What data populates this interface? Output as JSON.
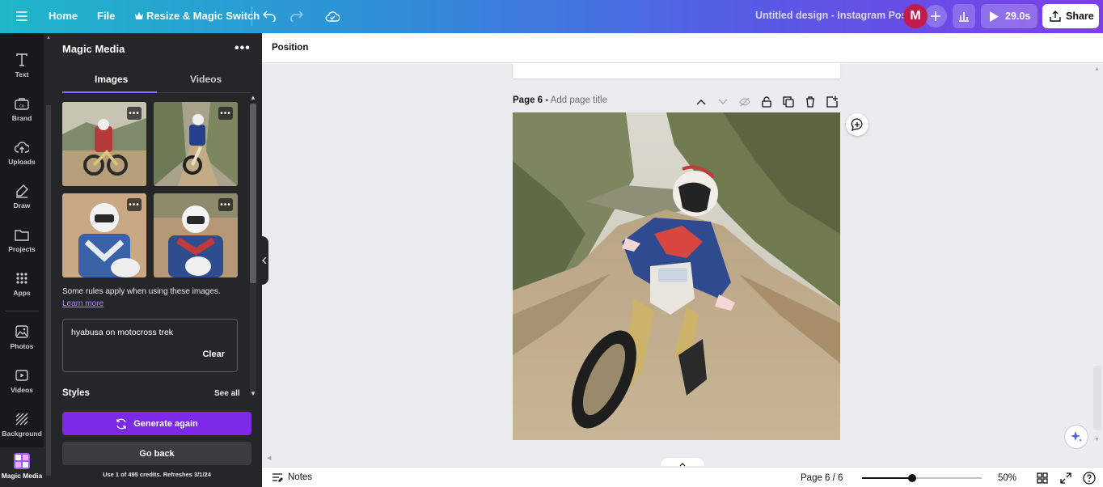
{
  "topbar": {
    "home": "Home",
    "file": "File",
    "resize": "Resize & Magic Switch",
    "doc_title": "Untitled design - Instagram Post",
    "avatar_initial": "M",
    "timer": "29.0s",
    "share": "Share"
  },
  "rail": {
    "items": [
      {
        "label": "Text",
        "icon": "text-icon"
      },
      {
        "label": "Brand",
        "icon": "brand-icon"
      },
      {
        "label": "Uploads",
        "icon": "uploads-icon"
      },
      {
        "label": "Draw",
        "icon": "draw-icon"
      },
      {
        "label": "Projects",
        "icon": "folder-icon"
      },
      {
        "label": "Apps",
        "icon": "apps-grid-icon"
      },
      {
        "label": "Photos",
        "icon": "photos-icon"
      },
      {
        "label": "Videos",
        "icon": "videos-icon"
      },
      {
        "label": "Background",
        "icon": "background-icon"
      },
      {
        "label": "Magic Media",
        "icon": "magic-media-icon"
      }
    ]
  },
  "panel": {
    "title": "Magic Media",
    "tabs": [
      "Images",
      "Videos"
    ],
    "active_tab": "Images",
    "rules_text": "Some rules apply when using these images.",
    "rules_link": "Learn more",
    "prompt": "hyabusa on motocross trek",
    "clear": "Clear",
    "styles": "Styles",
    "see_all": "See all",
    "generate_again": "Generate again",
    "go_back": "Go back",
    "credits": "Use 1 of 495 credits. Refreshes 3/1/24"
  },
  "canvas": {
    "position": "Position",
    "page_prefix": "Page 6 -",
    "page_title_placeholder": "Add page title"
  },
  "footer": {
    "notes": "Notes",
    "page_info": "Page 6 / 6",
    "zoom_level": 0.42,
    "zoom": "50%"
  },
  "colors": {
    "accent": "#7d2ae8",
    "avatar": "#c21a4a"
  }
}
